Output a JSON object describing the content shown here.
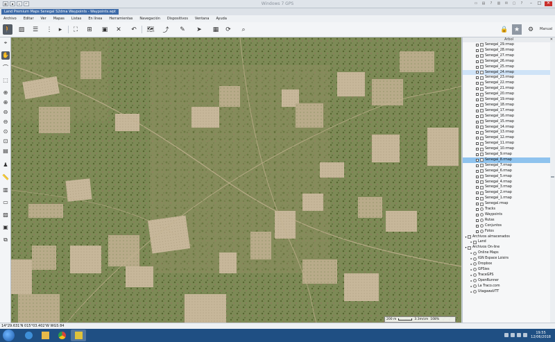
{
  "window": {
    "title": "Windows 7 GPS",
    "doc_tab": "Land Premium Maps Senegal S2dma Waypoints - Waypoints.wpt",
    "tray_icons": [
      "folder-icon",
      "document-icon",
      "question-icon",
      "print-icon",
      "mail-icon",
      "monitor-icon",
      "help-icon"
    ],
    "controls": [
      "–",
      "□",
      "✕"
    ]
  },
  "menu": [
    "Archivo",
    "Editar",
    "Ver",
    "Mapas",
    "Listas",
    "En línea",
    "Herramientas",
    "Navegación",
    "Dispositivos",
    "Ventana",
    "Ayuda"
  ],
  "toolbar": {
    "mode_label": "Manual"
  },
  "panel": {
    "title": "Árbol",
    "maps": [
      "Senegal_29.rmap",
      "Senegal_28.rmap",
      "Senegal_27.rmap",
      "Senegal_26.rmap",
      "Senegal_25.rmap",
      "Senegal_24.rmap",
      "Senegal_23.rmap",
      "Senegal_22.rmap",
      "Senegal_21.rmap",
      "Senegal_20.rmap",
      "Senegal_19.rmap",
      "Senegal_18.rmap",
      "Senegal_17.rmap",
      "Senegal_16.rmap",
      "Senegal_15.rmap",
      "Senegal_14.rmap",
      "Senegal_13.rmap",
      "Senegal_12.rmap",
      "Senegal_11.rmap",
      "Senegal_10.rmap",
      "Senegal_9.rmap",
      "Senegal_8.rmap",
      "Senegal_7.rmap",
      "Senegal_6.rmap",
      "Senegal_5.rmap",
      "Senegal_4.rmap",
      "Senegal_3.rmap",
      "Senegal_2.rmap",
      "Senegal_1.rmap",
      "Senegal.rmap"
    ],
    "layers": [
      "Tracks",
      "Waypoints",
      "Rutas",
      "Conjuntos",
      "Fotos"
    ],
    "stored_title": "Archivos almacenados",
    "stored": [
      "Land"
    ],
    "online_title": "Archivos On-line",
    "online": [
      "Online Maps",
      "IGN Espace Loisirs",
      "Dropbox",
      "GPSies",
      "TraceGPS",
      "OpenRunner",
      "La Traco.com",
      "UtagawaVTT"
    ]
  },
  "scalebar": {
    "left": "200 m",
    "middle": "3.3m/cm",
    "right": "108%"
  },
  "status": {
    "coords": "14°29.631'N 015°03.402'W  WGS 84"
  },
  "taskbar": {
    "time": "19:55",
    "date": "12/06/2018"
  },
  "colors": {
    "accent": "#3c6aa8",
    "taskbar": "#1f4f83",
    "selection": "#8fc3ee"
  }
}
